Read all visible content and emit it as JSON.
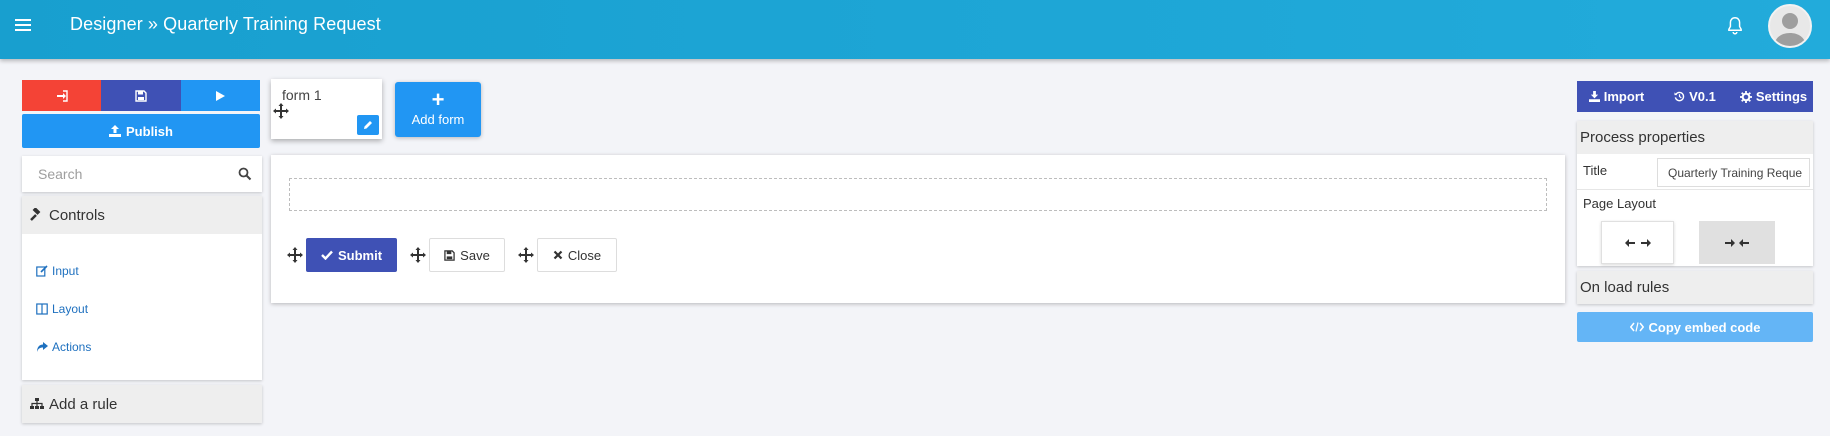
{
  "header": {
    "title": "Designer » Quarterly Training Request",
    "menu_icon": "menu-icon",
    "bell_icon": "bell-icon",
    "avatar_icon": "user-avatar-icon",
    "bg_color": "#1ea6d6"
  },
  "toolbar": {
    "exit_icon": "sign-in-icon",
    "save_icon": "floppy-disk-icon",
    "run_icon": "play-icon",
    "publish_label": "Publish",
    "publish_icon": "upload-icon",
    "colors": {
      "exit": "#f44336",
      "save": "#3f51b5",
      "run": "#2196f3"
    }
  },
  "search": {
    "placeholder": "Search",
    "value": ""
  },
  "controls": {
    "title": "Controls",
    "items": [
      {
        "label": "Input",
        "icon": "edit-icon"
      },
      {
        "label": "Layout",
        "icon": "columns-icon"
      },
      {
        "label": "Actions",
        "icon": "share-icon"
      }
    ]
  },
  "rules": {
    "add_rule_label": "Add a rule",
    "icon": "sitemap-icon"
  },
  "forms": {
    "tabs": [
      {
        "label": "form 1"
      }
    ],
    "add_form_label": "Add form",
    "add_form_symbol": "+"
  },
  "canvas": {
    "actions": [
      {
        "label": "Submit",
        "icon": "check-icon"
      },
      {
        "label": "Save",
        "icon": "floppy-disk-icon"
      },
      {
        "label": "Close",
        "icon": "times-icon"
      }
    ]
  },
  "right": {
    "import_label": "Import",
    "version_label": "V0.1",
    "settings_label": "Settings",
    "process_properties_label": "Process properties",
    "title_label": "Title",
    "title_value": "Quarterly Training Reque",
    "page_layout_label": "Page Layout",
    "layout_wide_icon": "arrows-h-icon",
    "layout_narrow_icon": "compress-h-icon",
    "on_load_rules_label": "On load rules",
    "copy_embed_label": "Copy embed code",
    "accent_color": "#3f51b5"
  }
}
